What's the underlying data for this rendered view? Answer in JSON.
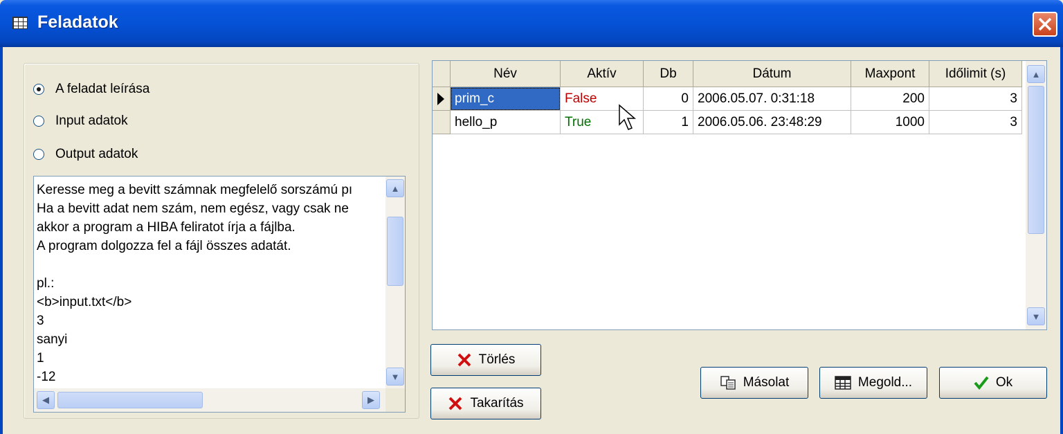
{
  "window": {
    "title": "Feladatok",
    "accent": "#0552d6"
  },
  "radios": [
    {
      "label": "A feladat leírása",
      "checked": true
    },
    {
      "label": "Input adatok",
      "checked": false
    },
    {
      "label": "Output adatok",
      "checked": false
    }
  ],
  "memo": {
    "text": "Keresse meg a bevitt számnak megfelelő sorszámú pı\nHa a bevitt adat nem szám, nem egész, vagy csak ne\nakkor a program a HIBA feliratot írja a fájlba.\nA program dolgozza fel a fájl összes adatát.\n\npl.:\n<b>input.txt</b>\n3\nsanyi\n1\n-12"
  },
  "table": {
    "columns": [
      "Név",
      "Aktív",
      "Db",
      "Dátum",
      "Maxpont",
      "Időlimit (s)"
    ],
    "rows": [
      {
        "nev": "prim_c",
        "aktiv": "False",
        "db": "0",
        "datum": "2006.05.07. 0:31:18",
        "maxpont": "200",
        "idolimit": "3"
      },
      {
        "nev": "hello_p",
        "aktiv": "True",
        "db": "1",
        "datum": "2006.05.06. 23:48:29",
        "maxpont": "1000",
        "idolimit": "3"
      }
    ],
    "false_color": "#c00000",
    "true_color": "#007000",
    "selection_color": "#316ac5"
  },
  "buttons": {
    "torles": "Törlés",
    "takaritas": "Takarítás",
    "masolat": "Másolat",
    "megold": "Megold...",
    "ok": "Ok"
  },
  "icons": {
    "close": "close-icon",
    "app": "grid-icon",
    "delete": "red-x-icon",
    "copy": "copy-icon",
    "table": "table-icon",
    "ok": "checkmark-icon",
    "cursor": "mouse-pointer-icon"
  }
}
